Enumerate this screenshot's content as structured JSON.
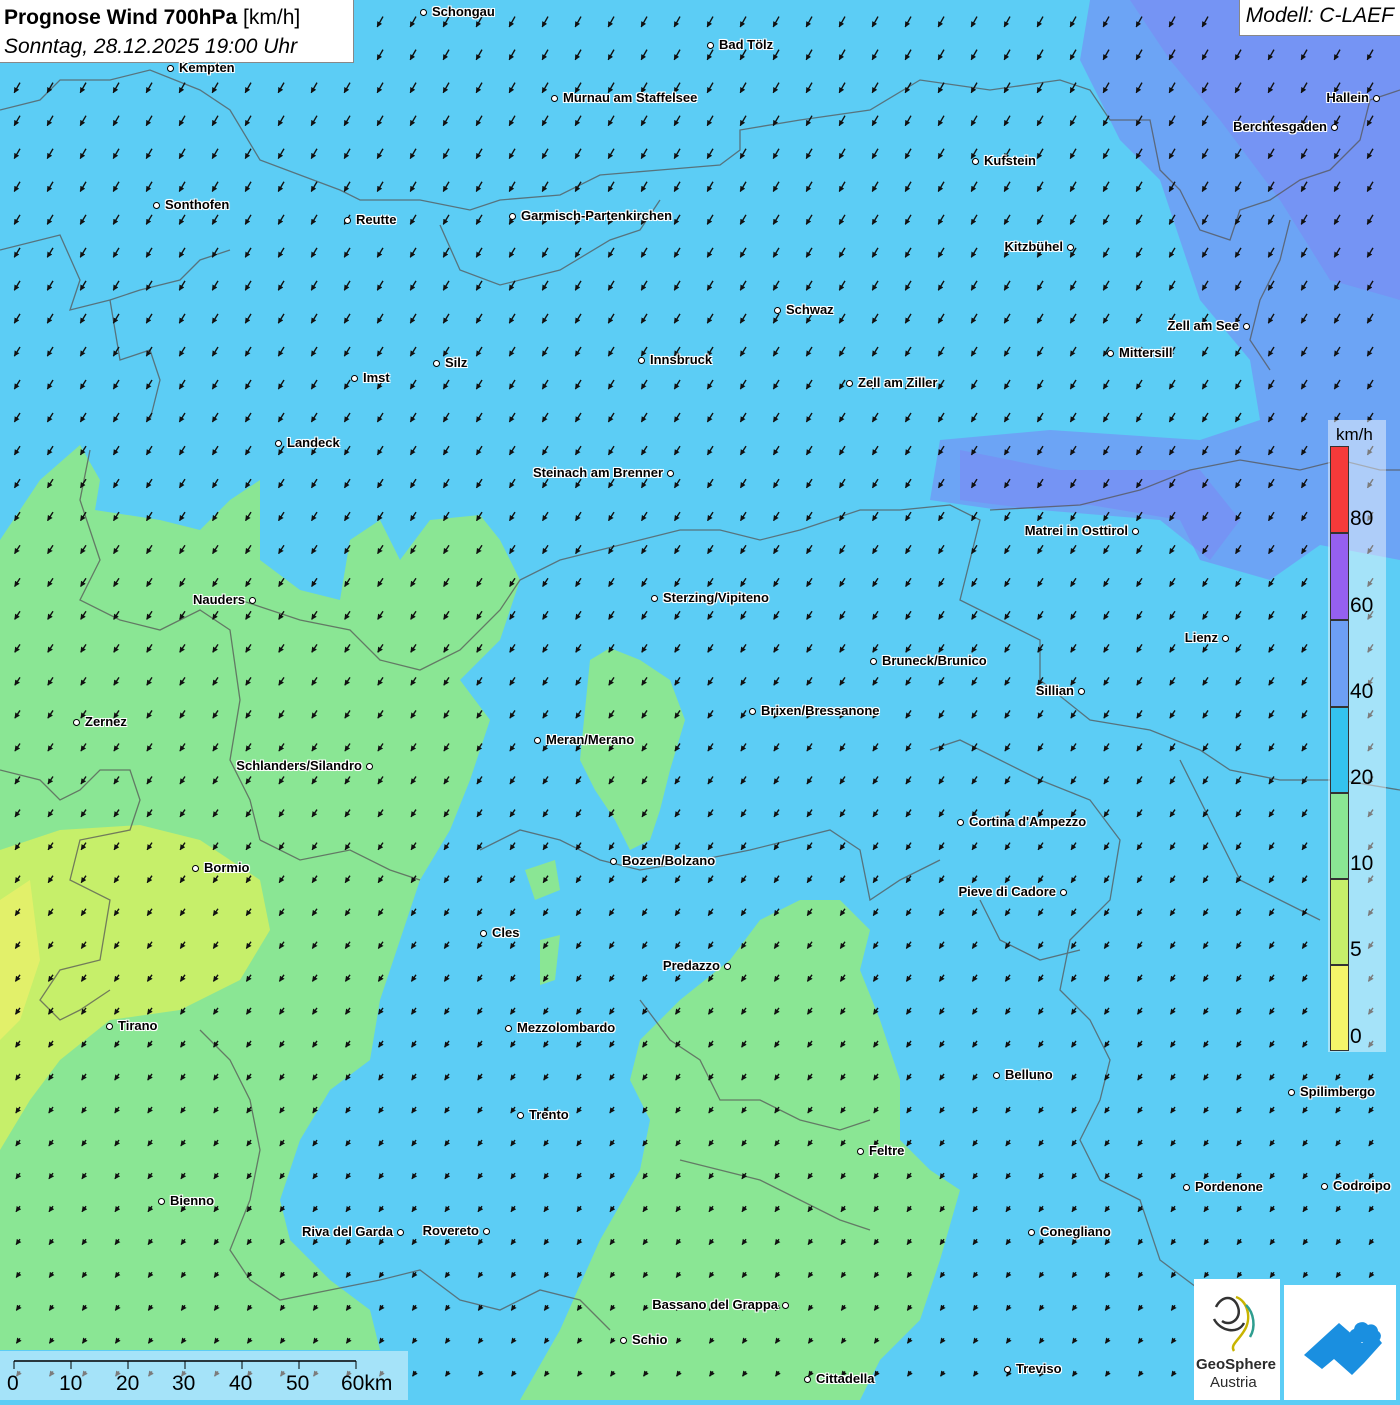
{
  "header": {
    "title_bold": "Prognose Wind 700hPa",
    "title_unit": "[km/h]",
    "subtitle": "Sonntag, 28.12.2025 19:00 Uhr",
    "model": "Modell: C-LAEF"
  },
  "colors": {
    "wind_0_5": "#f4f56a",
    "wind_5_10": "#c6ef6a",
    "wind_10_20": "#8ae694",
    "wind_20_40": "#5ccdf5",
    "wind_40_60": "#6d9ff5",
    "wind_60_80": "#8c6ff0",
    "wind_80_plus": "#f53a3a"
  },
  "legend": {
    "unit": "km/h",
    "ticks": [
      "80",
      "60",
      "40",
      "20",
      "10",
      "5",
      "0"
    ]
  },
  "scalebar": {
    "labels": [
      "0",
      "10",
      "20",
      "30",
      "40",
      "50",
      "60km"
    ]
  },
  "logos": {
    "geosphere_line1": "GeoSphere",
    "geosphere_line2": "Austria"
  },
  "cities": [
    {
      "name": "Schongau"
    },
    {
      "name": "Bad Tölz"
    },
    {
      "name": "Kempten"
    },
    {
      "name": "Murnau am Staffelsee"
    },
    {
      "name": "Hallein"
    },
    {
      "name": "Berchtesgaden"
    },
    {
      "name": "Kufstein"
    },
    {
      "name": "Sonthofen"
    },
    {
      "name": "Reutte"
    },
    {
      "name": "Garmisch-Partenkirchen"
    },
    {
      "name": "Kitzbühel"
    },
    {
      "name": "Schwaz"
    },
    {
      "name": "Zell am See"
    },
    {
      "name": "Mittersill"
    },
    {
      "name": "Innsbruck"
    },
    {
      "name": "Silz"
    },
    {
      "name": "Imst"
    },
    {
      "name": "Zell am Ziller"
    },
    {
      "name": "Landeck"
    },
    {
      "name": "Steinach am Brenner"
    },
    {
      "name": "Matrei in Osttirol"
    },
    {
      "name": "Nauders"
    },
    {
      "name": "Sterzing/Vipiteno"
    },
    {
      "name": "Lienz"
    },
    {
      "name": "Bruneck/Brunico"
    },
    {
      "name": "Sillian"
    },
    {
      "name": "Brixen/Bressanone"
    },
    {
      "name": "Zernez"
    },
    {
      "name": "Meran/Merano"
    },
    {
      "name": "Schlanders/Silandro"
    },
    {
      "name": "Cortina d'Ampezzo"
    },
    {
      "name": "Bozen/Bolzano"
    },
    {
      "name": "Bormio"
    },
    {
      "name": "Pieve di Cadore"
    },
    {
      "name": "Cles"
    },
    {
      "name": "Predazzo"
    },
    {
      "name": "Tirano"
    },
    {
      "name": "Mezzolombardo"
    },
    {
      "name": "Belluno"
    },
    {
      "name": "Spilimbergo"
    },
    {
      "name": "Trento"
    },
    {
      "name": "Feltre"
    },
    {
      "name": "Pordenone"
    },
    {
      "name": "Codroipo"
    },
    {
      "name": "Bienno"
    },
    {
      "name": "Riva del Garda"
    },
    {
      "name": "Rovereto"
    },
    {
      "name": "Conegliano"
    },
    {
      "name": "Bassano del Grappa"
    },
    {
      "name": "Schio"
    },
    {
      "name": "Treviso"
    },
    {
      "name": "Cittadella"
    }
  ]
}
